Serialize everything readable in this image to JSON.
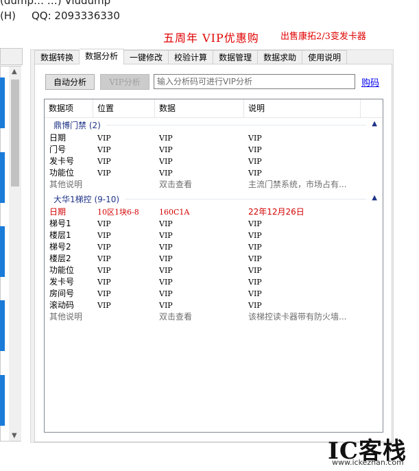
{
  "titlebar": {
    "text": "(dump…  …)  Viudump",
    "menu_help": "(H)",
    "qq": "QQ: 2093336330"
  },
  "promo": {
    "anniversary": "五周年 VIP优惠购",
    "sale": "出售康拓2/3变发卡器"
  },
  "tabs": [
    {
      "label": "数据转换",
      "active": false
    },
    {
      "label": "数据分析",
      "active": true
    },
    {
      "label": "一键修改",
      "active": false
    },
    {
      "label": "校验计算",
      "active": false
    },
    {
      "label": "数据管理",
      "active": false
    },
    {
      "label": "数据求助",
      "active": false
    },
    {
      "label": "使用说明",
      "active": false
    }
  ],
  "toolbar": {
    "auto_analyze": "自动分析",
    "vip_analyze": "VIP分析",
    "code_placeholder": "输入分析码可进行VIP分析",
    "buy": "购码"
  },
  "list": {
    "columns": [
      "数据项",
      "位置",
      "数据",
      "说明"
    ],
    "groups": [
      {
        "name": "鼎博门禁 (2)",
        "rows": [
          {
            "item": "日期",
            "pos": "VIP",
            "data": "VIP",
            "note": "VIP",
            "style": "normal"
          },
          {
            "item": "门号",
            "pos": "VIP",
            "data": "VIP",
            "note": "VIP",
            "style": "normal"
          },
          {
            "item": "发卡号",
            "pos": "VIP",
            "data": "VIP",
            "note": "VIP",
            "style": "normal"
          },
          {
            "item": "功能位",
            "pos": "VIP",
            "data": "VIP",
            "note": "VIP",
            "style": "normal"
          },
          {
            "item": "其他说明",
            "pos": "",
            "data": "双击查看",
            "note": "主流门禁系统，市场占有...",
            "style": "gray"
          }
        ]
      },
      {
        "name": "大华1梯控 (9-10)",
        "rows": [
          {
            "item": "日期",
            "pos": "10区1块6-8",
            "data": "160C1A",
            "note": "22年12月26日",
            "style": "red"
          },
          {
            "item": "梯号1",
            "pos": "VIP",
            "data": "VIP",
            "note": "VIP",
            "style": "normal"
          },
          {
            "item": "楼层1",
            "pos": "VIP",
            "data": "VIP",
            "note": "VIP",
            "style": "normal"
          },
          {
            "item": "梯号2",
            "pos": "VIP",
            "data": "VIP",
            "note": "VIP",
            "style": "normal"
          },
          {
            "item": "楼层2",
            "pos": "VIP",
            "data": "VIP",
            "note": "VIP",
            "style": "normal"
          },
          {
            "item": "功能位",
            "pos": "VIP",
            "data": "VIP",
            "note": "VIP",
            "style": "normal"
          },
          {
            "item": "发卡号",
            "pos": "VIP",
            "data": "VIP",
            "note": "VIP",
            "style": "normal"
          },
          {
            "item": "房间号",
            "pos": "VIP",
            "data": "VIP",
            "note": "VIP",
            "style": "normal"
          },
          {
            "item": "滚动码",
            "pos": "VIP",
            "data": "VIP",
            "note": "VIP",
            "style": "normal"
          },
          {
            "item": "其他说明",
            "pos": "",
            "data": "双击查看",
            "note": "该梯控读卡器带有防火墙...",
            "style": "gray"
          }
        ]
      }
    ]
  },
  "watermark": {
    "logo": "IC客栈",
    "url": "www.ickezhan.com"
  },
  "colors": {
    "accent_blue": "#1a7bd9",
    "promo_red": "#e00000",
    "group_blue": "#1e3287",
    "highlight_red": "#d40000"
  }
}
